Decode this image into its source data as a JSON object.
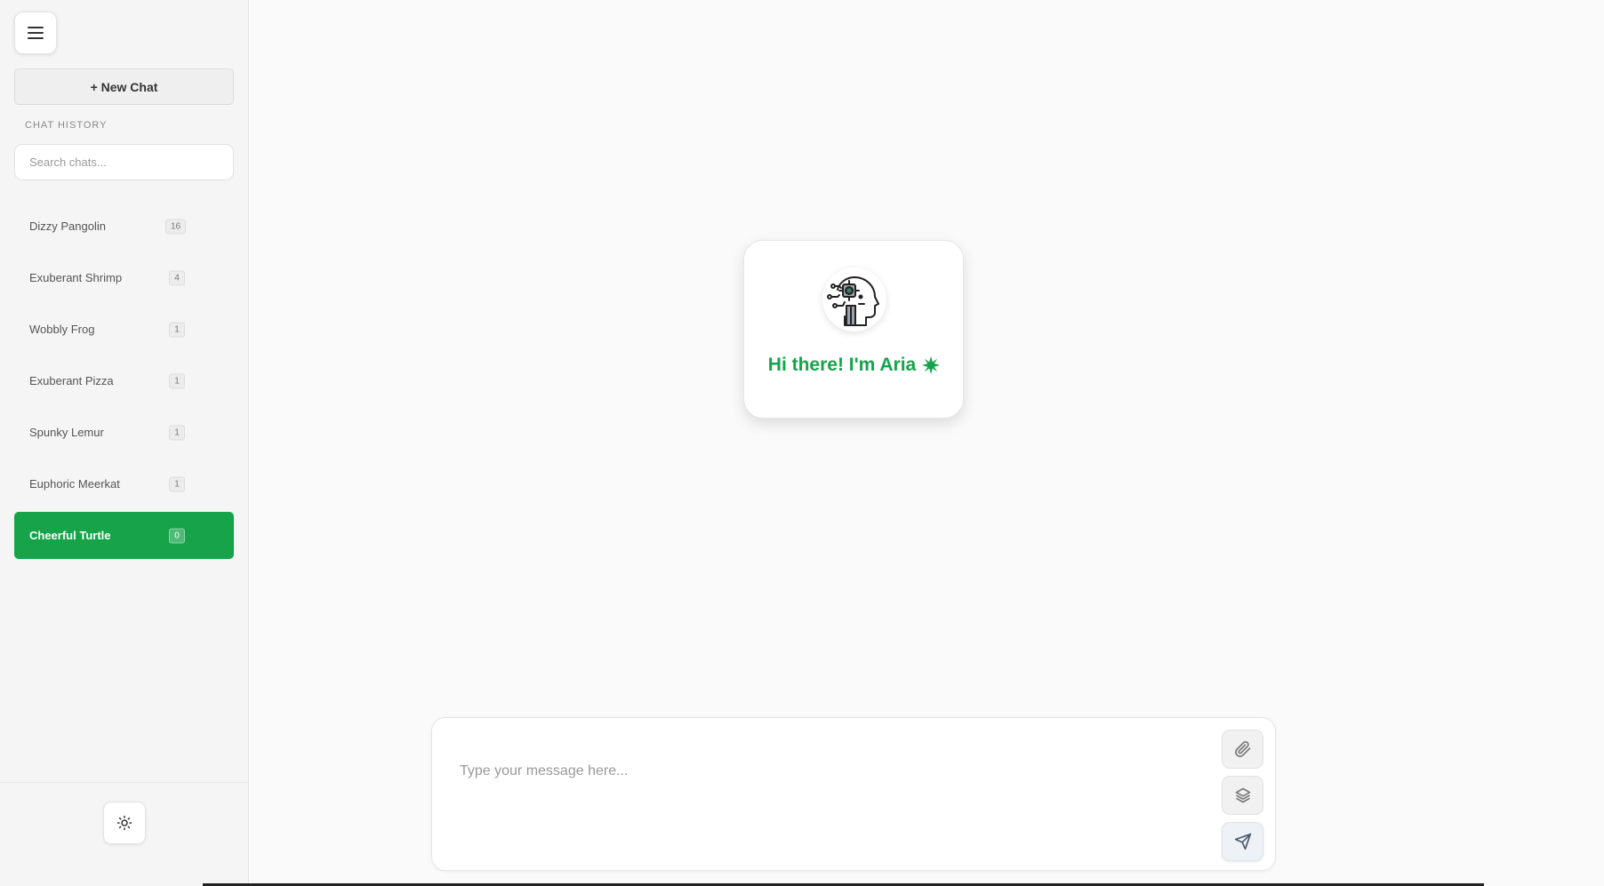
{
  "sidebar": {
    "menu_icon": "hamburger-menu-icon",
    "new_chat_label": "+ New Chat",
    "history_label": "CHAT HISTORY",
    "search_placeholder": "Search chats...",
    "chats": [
      {
        "name": "Dizzy Pangolin",
        "count": "16",
        "active": false
      },
      {
        "name": "Exuberant Shrimp",
        "count": "4",
        "active": false
      },
      {
        "name": "Wobbly Frog",
        "count": "1",
        "active": false
      },
      {
        "name": "Exuberant Pizza",
        "count": "1",
        "active": false
      },
      {
        "name": "Spunky Lemur",
        "count": "1",
        "active": false
      },
      {
        "name": "Euphoric Meerkat",
        "count": "1",
        "active": false
      },
      {
        "name": "Cheerful Turtle",
        "count": "0",
        "active": true
      }
    ],
    "theme_icon": "sun-icon"
  },
  "greeting": {
    "text": "Hi there! I'm Aria",
    "avatar_icon": "robot-head-icon",
    "sparkle_icon": "sparkle-icon"
  },
  "composer": {
    "placeholder": "Type your message here...",
    "attach_icon": "paperclip-icon",
    "layers_icon": "layers-icon",
    "send_icon": "send-icon"
  },
  "colors": {
    "accent": "#16a34a",
    "background": "#fafafa",
    "sidebar": "#f5f5f5"
  }
}
